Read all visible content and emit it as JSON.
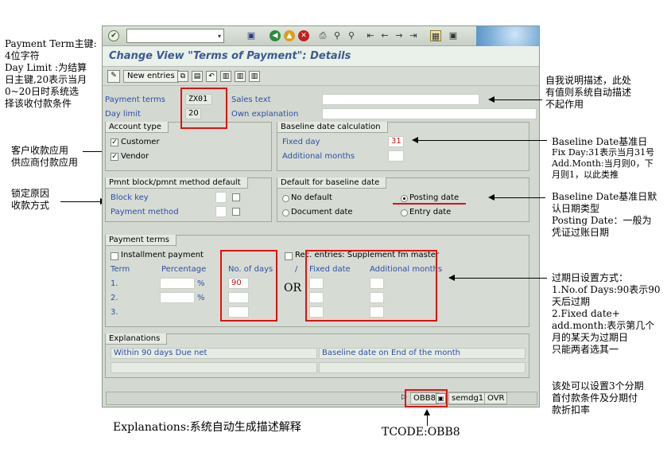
{
  "toolbar": {
    "icons": [
      "checkmark-icon",
      "save-icon",
      "back-icon",
      "exit-icon",
      "cancel-icon",
      "print-icon",
      "find-icon",
      "find-next-icon",
      "first-page-icon",
      "prev-page-icon",
      "next-page-icon",
      "last-page-icon",
      "layout-icon",
      "help-icon"
    ]
  },
  "window": {
    "title": "Change View \"Terms of Payment\": Details"
  },
  "app_toolbar": {
    "new_entries": "New entries"
  },
  "header": {
    "payment_terms_label": "Payment terms",
    "payment_terms_value": "ZX01",
    "day_limit_label": "Day limit",
    "day_limit_value": "20",
    "sales_text_label": "Sales text",
    "sales_text_value": "",
    "own_explanation_label": "Own explanation",
    "own_explanation_value": ""
  },
  "account_type": {
    "title": "Account type",
    "customer_label": "Customer",
    "customer_checked": true,
    "vendor_label": "Vendor",
    "vendor_checked": true
  },
  "baseline_calc": {
    "title": "Baseline date calculation",
    "fixed_day_label": "Fixed day",
    "fixed_day_value": "31",
    "additional_months_label": "Additional months",
    "additional_months_value": ""
  },
  "pmnt_block": {
    "title": "Pmnt block/pmnt method default",
    "block_key_label": "Block key",
    "payment_method_label": "Payment method"
  },
  "default_baseline": {
    "title": "Default for baseline date",
    "no_default": "No default",
    "document_date": "Document date",
    "posting_date": "Posting date",
    "entry_date": "Entry date",
    "selected": "Posting date"
  },
  "payment_terms": {
    "title": "Payment terms",
    "installment_label": "Installment payment",
    "rec_entries_label": "Rec. entries: Supplement fm master",
    "col_term": "Term",
    "col_percentage": "Percentage",
    "col_no_of_days": "No. of days",
    "col_slash": "/",
    "col_fixed_date": "Fixed date",
    "col_additional_months": "Additional months",
    "pct_unit": "%",
    "rows": [
      {
        "term": "1.",
        "percentage": "",
        "days": "90"
      },
      {
        "term": "2.",
        "percentage": "",
        "days": ""
      },
      {
        "term": "3.",
        "percentage": "",
        "days": ""
      }
    ]
  },
  "explanations": {
    "title": "Explanations",
    "line1_left": "Within 90 days Due net",
    "line1_right": "Baseline date on End of the month"
  },
  "statusbar": {
    "tcode": "OBB8",
    "user": "semdg1",
    "mode": "OVR"
  },
  "annotations": {
    "left_top": [
      "Payment Term主键:",
      "4位字符",
      "Day Limit :为结算",
      "日主键,20表示当月",
      "0~20日时系统选",
      "择该收付款条件"
    ],
    "left_account": [
      "客户收款应用",
      "供应商付款应用"
    ],
    "left_block": [
      "锁定原因",
      "收款方式"
    ],
    "right_desc": [
      "自我说明描述，此处",
      "有值则系统自动描述",
      "不起作用"
    ],
    "right_baseline": [
      "Baseline Date基准日",
      "Fix Day:31表示当月31号",
      "Add.Month:当月则0，下",
      "月则1，以此类推"
    ],
    "right_default": [
      "Baseline Date基准日默",
      "认日期类型",
      "Posting Date：一般为",
      "凭证过账日期"
    ],
    "right_terms": [
      "过期日设置方式：",
      "1.No.of Days:90表示90",
      "天后过期",
      "2.Fixed date+",
      "add.month:表示第几个",
      "月的某天为过期日",
      "只能两者选其一"
    ],
    "right_installment": [
      "该处可以设置3个分期",
      "首付款条件及分期付",
      "款折扣率"
    ],
    "or_label": "OR",
    "bottom_explanations": "Explanations:系统自动生成描述解释",
    "bottom_tcode": "TCODE:OBB8"
  }
}
